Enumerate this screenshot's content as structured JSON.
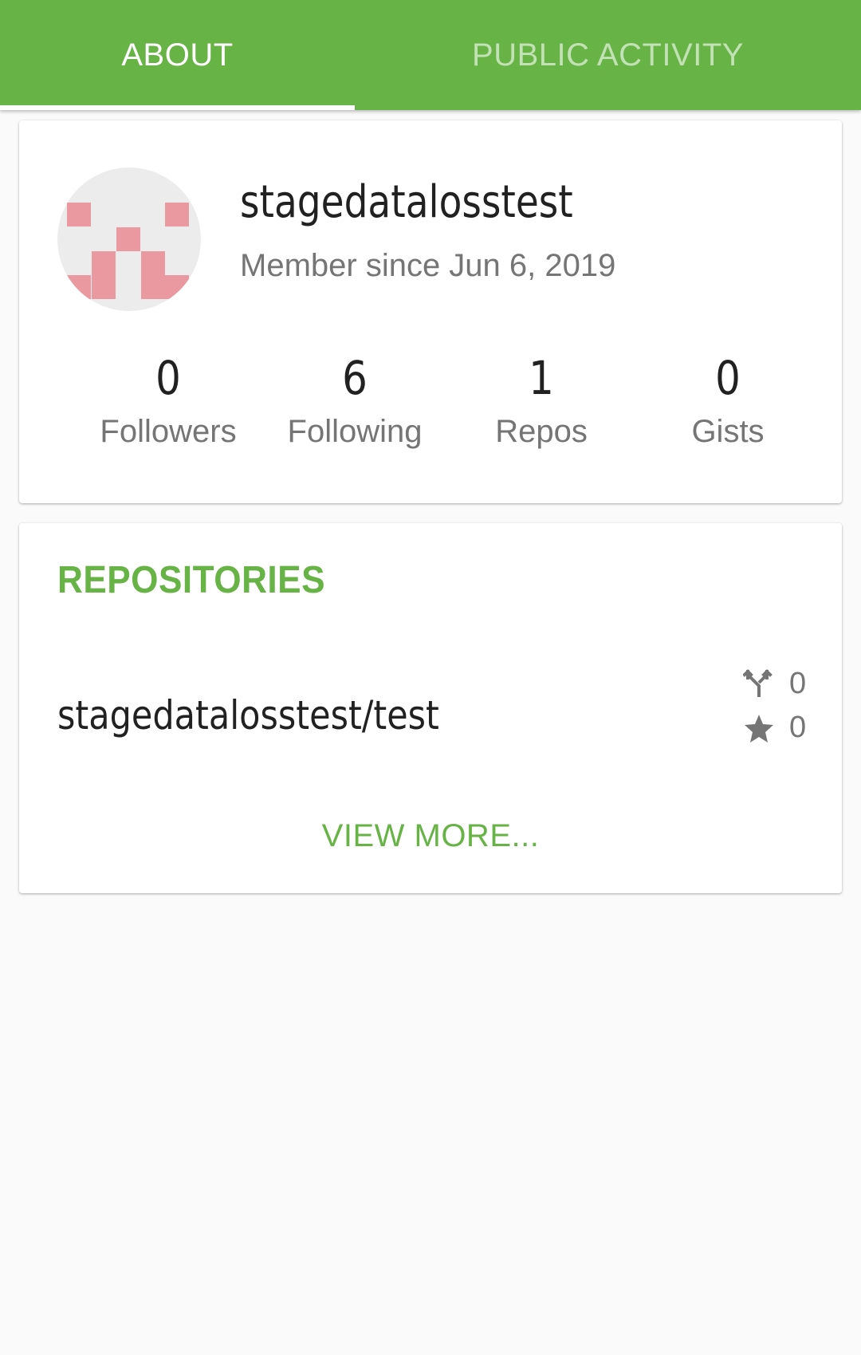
{
  "tabs": [
    {
      "label": "ABOUT",
      "active": true
    },
    {
      "label": "PUBLIC ACTIVITY",
      "active": false
    }
  ],
  "profile": {
    "username": "stagedatalosstest",
    "member_since": "Member since Jun 6, 2019",
    "avatar_icon": "identicon-avatar",
    "stats": [
      {
        "value": "0",
        "label": "Followers"
      },
      {
        "value": "6",
        "label": "Following"
      },
      {
        "value": "1",
        "label": "Repos"
      },
      {
        "value": "0",
        "label": "Gists"
      }
    ]
  },
  "repositories": {
    "title": "REPOSITORIES",
    "items": [
      {
        "name": "stagedatalosstest/test",
        "forks": "0",
        "stars": "0"
      }
    ],
    "view_more_label": "VIEW MORE..."
  },
  "colors": {
    "accent": "#67b346",
    "avatar_pink": "#e9999f"
  }
}
